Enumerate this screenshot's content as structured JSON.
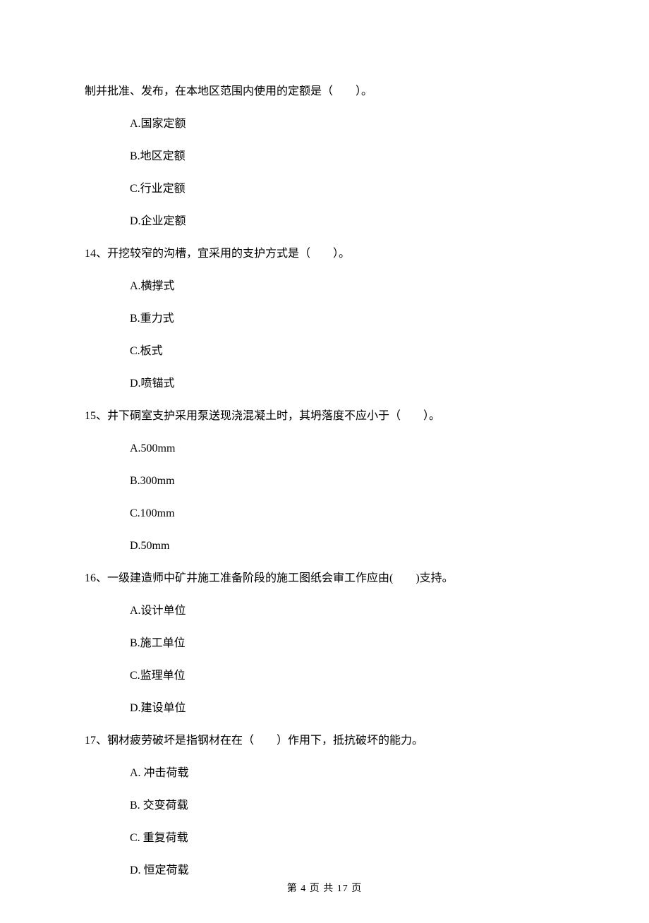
{
  "intro": {
    "fragment": "制并批准、发布，在本地区范围内使用的定额是（　　）。",
    "options": {
      "A": "A.国家定额",
      "B": "B.地区定额",
      "C": "C.行业定额",
      "D": "D.企业定额"
    }
  },
  "q14": {
    "stem": "14、开挖较窄的沟槽，宜采用的支护方式是（　　）。",
    "options": {
      "A": "A.横撑式",
      "B": "B.重力式",
      "C": "C.板式",
      "D": "D.喷锚式"
    }
  },
  "q15": {
    "stem": "15、井下硐室支护采用泵送现浇混凝土时，其坍落度不应小于（　　）。",
    "options": {
      "A": "A.500mm",
      "B": "B.300mm",
      "C": "C.100mm",
      "D": "D.50mm"
    }
  },
  "q16": {
    "stem": "16、一级建造师中矿井施工准备阶段的施工图纸会审工作应由(　　)支持。",
    "options": {
      "A": "A.设计单位",
      "B": "B.施工单位",
      "C": "C.监理单位",
      "D": "D.建设单位"
    }
  },
  "q17": {
    "stem": "17、钢材疲劳破坏是指钢材在在（　　）作用下，抵抗破坏的能力。",
    "options": {
      "A": "A. 冲击荷载",
      "B": "B. 交变荷载",
      "C": "C. 重复荷载",
      "D": "D. 恒定荷载"
    }
  },
  "footer": "第 4 页 共 17 页"
}
